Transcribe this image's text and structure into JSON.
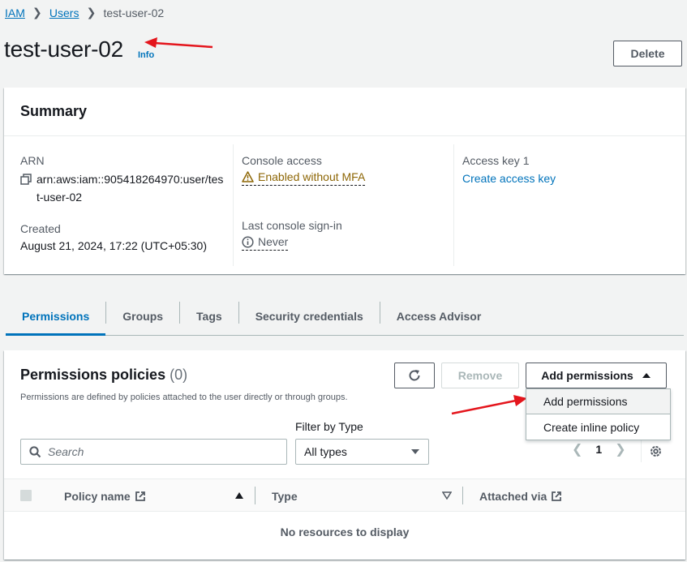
{
  "breadcrumb": {
    "items": [
      "IAM",
      "Users"
    ],
    "current": "test-user-02"
  },
  "header": {
    "title": "test-user-02",
    "info": "Info",
    "delete_label": "Delete"
  },
  "summary": {
    "title": "Summary",
    "arn_label": "ARN",
    "arn_value": "arn:aws:iam::905418264970:user/test-user-02",
    "created_label": "Created",
    "created_value": "August 21, 2024, 17:22 (UTC+05:30)",
    "console_access_label": "Console access",
    "console_access_value": "Enabled without MFA",
    "last_signin_label": "Last console sign-in",
    "last_signin_value": "Never",
    "access_key_label": "Access key 1",
    "access_key_link": "Create access key"
  },
  "tabs": [
    {
      "label": "Permissions",
      "active": true
    },
    {
      "label": "Groups"
    },
    {
      "label": "Tags"
    },
    {
      "label": "Security credentials"
    },
    {
      "label": "Access Advisor"
    }
  ],
  "permissions": {
    "title": "Permissions policies",
    "count": "(0)",
    "description": "Permissions are defined by policies attached to the user directly or through groups.",
    "remove_label": "Remove",
    "add_label": "Add permissions",
    "menu": [
      "Add permissions",
      "Create inline policy"
    ],
    "filter_label": "Filter by Type",
    "search_placeholder": "Search",
    "type_value": "All types",
    "page": "1",
    "columns": [
      "Policy name",
      "Type",
      "Attached via"
    ],
    "empty": "No resources to display"
  },
  "colors": {
    "link": "#0073bb",
    "arrow": "#e4151c",
    "warning": "#8d6605"
  }
}
